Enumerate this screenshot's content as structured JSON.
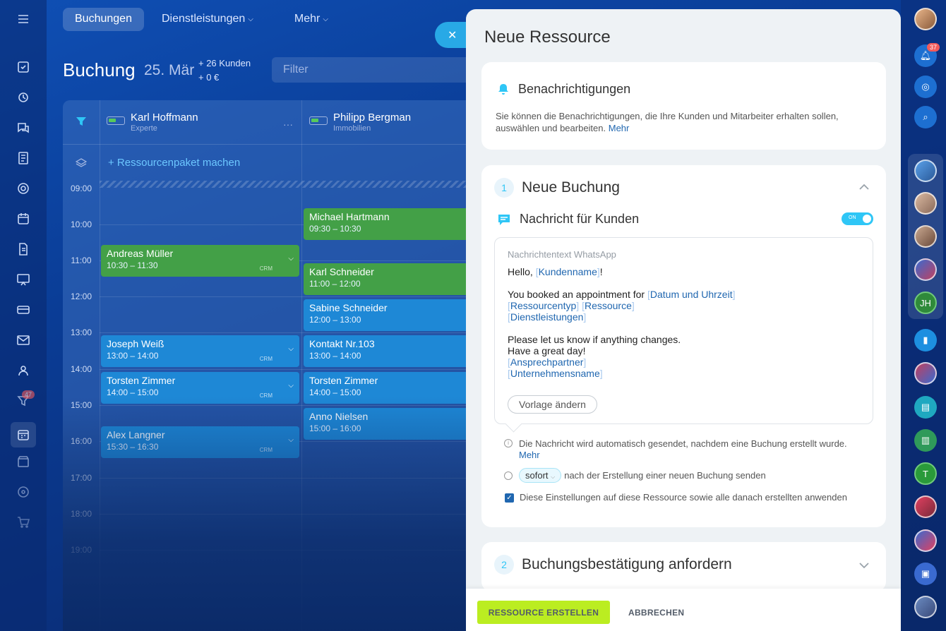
{
  "nav": {
    "tabs": [
      {
        "label": "Buchungen"
      },
      {
        "label": "Dienstleistungen"
      },
      {
        "label": "Mehr"
      }
    ]
  },
  "page": {
    "title": "Buchung",
    "date": "25. Mär",
    "count_clients": "+ 26 Kunden",
    "count_money": "+ 0 €",
    "filter_placeholder": "Filter"
  },
  "calendar": {
    "resources": [
      {
        "name": "Karl Hoffmann",
        "role": "Experte"
      },
      {
        "name": "Philipp Bergman",
        "role": "Immobilien"
      }
    ],
    "package_label": "+ Ressourcenpaket machen",
    "times": [
      "09:00",
      "10:00",
      "11:00",
      "12:00",
      "13:00",
      "14:00",
      "15:00",
      "16:00",
      "17:00",
      "18:00",
      "19:00"
    ],
    "events": [
      {
        "name": "Michael Hartmann",
        "time": "09:30 – 10:30"
      },
      {
        "name": "Andreas Müller",
        "time": "10:30 – 11:30"
      },
      {
        "name": "Karl Schneider",
        "time": "11:00 – 12:00"
      },
      {
        "name": "Sabine Schneider",
        "time": "12:00 – 13:00"
      },
      {
        "name": "Joseph Weiß",
        "time": "13:00 – 14:00"
      },
      {
        "name": "Kontakt Nr.103",
        "time": "13:00 – 14:00"
      },
      {
        "name": "Torsten Zimmer",
        "time": "14:00 – 15:00"
      },
      {
        "name": "Torsten Zimmer",
        "time": "14:00 – 15:00"
      },
      {
        "name": "Anno Nielsen",
        "time": "15:00 – 16:00"
      },
      {
        "name": "Alex Langner",
        "time": "15:30 – 16:30"
      }
    ],
    "crm": "CRM"
  },
  "sidebar_badge": "47",
  "right_bar": {
    "bell_badge": "37",
    "initials_jh": "JH",
    "initials_t": "T"
  },
  "panel": {
    "title": "Neue Ressource",
    "notifications": {
      "heading": "Benachrichtigungen",
      "description": "Sie können die Benachrichtigungen, die Ihre Kunden und Mitarbeiter erhalten sollen, auswählen und bearbeiten.",
      "more": "Mehr"
    },
    "step1": {
      "number": "1",
      "title": "Neue Buchung",
      "message_heading": "Nachricht für Kunden",
      "toggle": "ON",
      "message_label": "Nachrichtentext WhatsApp",
      "line_hello": "Hello,",
      "tag_customer": "Kundenname",
      "excl": "!",
      "line_booked": "You booked an appointment for",
      "tag_datetime": "Datum und Uhrzeit",
      "tag_restype": "Ressourcentyp",
      "tag_resource": "Ressource",
      "tag_services": "Dienstleistungen",
      "line_changes": "Please let us know if anything changes.",
      "line_day": "Have a great day!",
      "tag_contact": "Ansprechpartner",
      "tag_company": "Unternehmensname",
      "change_template": "Vorlage ändern",
      "info_text": "Die Nachricht wird automatisch gesendet, nachdem eine Buchung erstellt wurde.",
      "info_more": "Mehr",
      "timing_value": "sofort",
      "timing_text": "nach der Erstellung einer neuen Buchung senden",
      "apply_text": "Diese Einstellungen auf diese Ressource sowie alle danach erstellten anwenden"
    },
    "step2": {
      "number": "2",
      "title": "Buchungsbestätigung anfordern"
    },
    "buttons": {
      "create": "RESSOURCE ERSTELLEN",
      "cancel": "ABBRECHEN"
    }
  },
  "colors": {
    "accent": "#2fc6f6",
    "create_button": "#bbed21",
    "event_green": "#43a047",
    "event_blue": "#1e88d6",
    "link": "#2067b0"
  },
  "icons": [
    "menu-icon",
    "tasks-icon",
    "chat-icon",
    "calendar-icon",
    "bell-icon",
    "message-icon",
    "chevron-up-icon",
    "chevron-down-icon",
    "info-icon",
    "clock-icon",
    "close-icon",
    "filter-icon"
  ]
}
